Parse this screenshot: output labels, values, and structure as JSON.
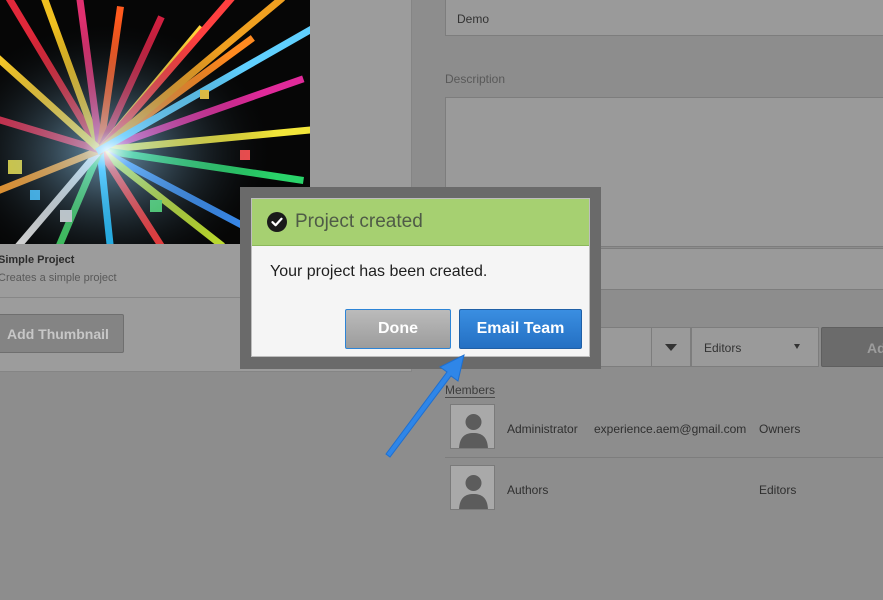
{
  "template": {
    "name": "Simple Project",
    "description": "Creates a simple project",
    "add_thumbnail_label": "Add Thumbnail"
  },
  "form": {
    "title_value": "Demo",
    "description_label": "Description",
    "role_value": "Editors",
    "add_label": "Ad"
  },
  "members": {
    "label": "Members",
    "rows": [
      {
        "name": "Administrator",
        "email": "experience.aem@gmail.com",
        "role": "Owners"
      },
      {
        "name": "Authors",
        "email": "",
        "role": "Editors"
      }
    ]
  },
  "dialog": {
    "title": "Project created",
    "message": "Your project has been created.",
    "done_label": "Done",
    "email_team_label": "Email Team",
    "colors": {
      "header": "#a6d071",
      "primary_button": "#2a7bd0",
      "annotation_arrow": "#2f86e8"
    }
  },
  "icons": {
    "dialog_status": "checkmark-circle-icon",
    "avatar": "user-silhouette-icon",
    "dropdown": "caret-down-icon"
  }
}
